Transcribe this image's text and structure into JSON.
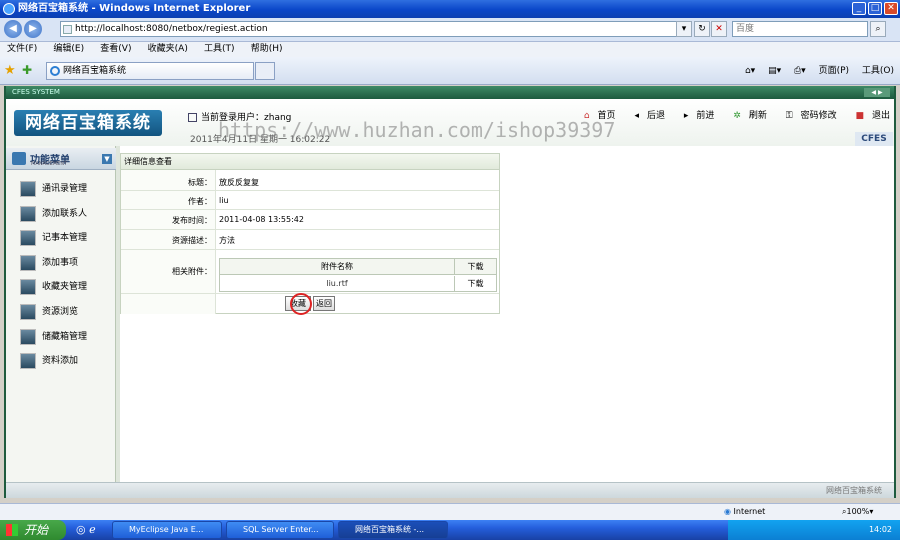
{
  "window": {
    "title": "网络百宝箱系统 - Windows Internet Explorer"
  },
  "browser": {
    "url": "http://localhost:8080/netbox/regiest.action",
    "search_placeholder": "百度",
    "menus": [
      "文件(F)",
      "编辑(E)",
      "查看(V)",
      "收藏夹(A)",
      "工具(T)",
      "帮助(H)"
    ],
    "tab_title": "网络百宝箱系统",
    "tools": [
      "页面(P)",
      "工具(O)"
    ],
    "status_zone": "Internet",
    "zoom": "100%"
  },
  "app": {
    "header_small": "CFES SYSTEM",
    "logo": "网络百宝箱系统",
    "current_user_label": "当前登录用户：",
    "current_user": "zhang",
    "date": "2011年4月11日 星期一 16:02:22",
    "top_nav": [
      "首页",
      "后退",
      "前进",
      "刷新",
      "密码修改",
      "退出"
    ],
    "badge": "CFES",
    "footer": "网络百宝箱系统"
  },
  "sidebar": {
    "title": "功能菜单",
    "subtitle": "MANAGEMENT",
    "items": [
      "通讯录管理",
      "添加联系人",
      "记事本管理",
      "添加事项",
      "收藏夹管理",
      "资源浏览",
      "储藏箱管理",
      "资料添加"
    ]
  },
  "detail": {
    "panel_title": "详细信息查看",
    "title_label": "标题：",
    "title_value": "放反反复复",
    "author_label": "作者：",
    "author_value": "liu",
    "published_label": "发布时间：",
    "published_value": "2011-04-08 13:55:42",
    "desc_label": "资源描述：",
    "desc_value": "方法",
    "attachments_label": "相关附件：",
    "attachments_header": {
      "name": "附件名称",
      "download": "下载"
    },
    "attachments": [
      {
        "name": "liu.rtf",
        "download": "下载"
      }
    ],
    "collect_button": "收藏",
    "back_button": "返回"
  },
  "watermark": "https://www.huzhan.com/ishop39397",
  "taskbar": {
    "start": "开始",
    "tasks": [
      "MyEclipse Java E...",
      "SQL Server Enter...",
      "网络百宝箱系统 -..."
    ],
    "time": "14:02"
  }
}
